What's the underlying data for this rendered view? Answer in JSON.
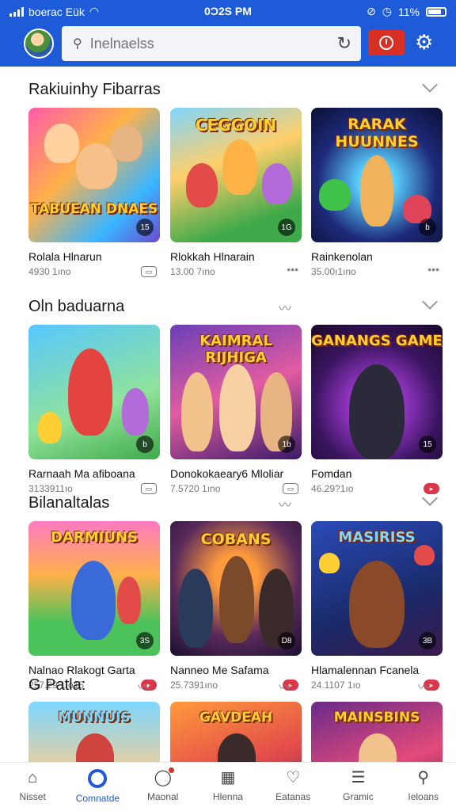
{
  "status": {
    "carrier": "boerac Eük",
    "time": "0Ɔ2S PM",
    "battery": "11%"
  },
  "search": {
    "placeholder": "Inelnaelss"
  },
  "sections": [
    {
      "title": "Rakiuinhy Fibarras",
      "cards": [
        {
          "art_title": "TABUEAN DNAES",
          "badge": "15",
          "name": "Rolala Hlnarun",
          "meta": "4930 1ıno",
          "tag": "gray"
        },
        {
          "art_title": "CEGGOIN",
          "badge": "1G",
          "name": "Rlokkah Hlnarain",
          "meta": "13.00 7ıno",
          "tag": "dots"
        },
        {
          "art_title": "RARAK HUUNNES",
          "badge": "b",
          "name": "Rainkenolan",
          "meta": "35.00ı1ıno",
          "tag": "dots"
        }
      ]
    },
    {
      "title": "Oln baduarna",
      "cards": [
        {
          "art_title": "",
          "badge": "b",
          "name": "Rarnaah Ma afiboana",
          "meta": "3133911ıo",
          "tag": "gray"
        },
        {
          "art_title": "KAIMRAL RIJHIGA",
          "badge": "1b",
          "name": "Donokokaeary6 Mloliar",
          "meta": "7.5720 1ıno",
          "tag": "gray"
        },
        {
          "art_title": "GANANGS GAME",
          "badge": "15",
          "name": "Fomdan",
          "meta": "46.29?1ıo",
          "tag": "red"
        }
      ]
    },
    {
      "title": "Bilanaltalas",
      "cards": [
        {
          "art_title": "DARMIUNS",
          "badge": "3S",
          "name": "Nalnao Rlakogt Garta",
          "meta": "257.29 1ıo15",
          "tag": "red"
        },
        {
          "art_title": "COBANS",
          "badge": "D8",
          "name": "Nanneo Me Safama",
          "meta": "25.7391ıno",
          "tag": "red"
        },
        {
          "art_title": "MASIRISS",
          "badge": "3B",
          "name": "Hlamalennan Fcanela",
          "meta": "24.1107 1ıo",
          "tag": "red"
        }
      ]
    },
    {
      "title": "G Patla:",
      "cards": [
        {
          "art_title": "MUNNUIS",
          "badge": "",
          "name": "",
          "meta": "",
          "tag": ""
        },
        {
          "art_title": "GAVDEAH",
          "badge": "",
          "name": "",
          "meta": "",
          "tag": ""
        },
        {
          "art_title": "MAINSBINS",
          "badge": "",
          "name": "",
          "meta": "",
          "tag": ""
        }
      ]
    }
  ],
  "nav": [
    {
      "label": "Nisset",
      "icon": "home-icon"
    },
    {
      "label": "Comnatde",
      "icon": "ring-icon"
    },
    {
      "label": "Maonal",
      "icon": "chat-icon"
    },
    {
      "label": "Hlenna",
      "icon": "grid-icon"
    },
    {
      "label": "Eatanas",
      "icon": "heart-icon"
    },
    {
      "label": "Gramic",
      "icon": "list-icon"
    },
    {
      "label": "Ieloans",
      "icon": "search-icon"
    }
  ]
}
